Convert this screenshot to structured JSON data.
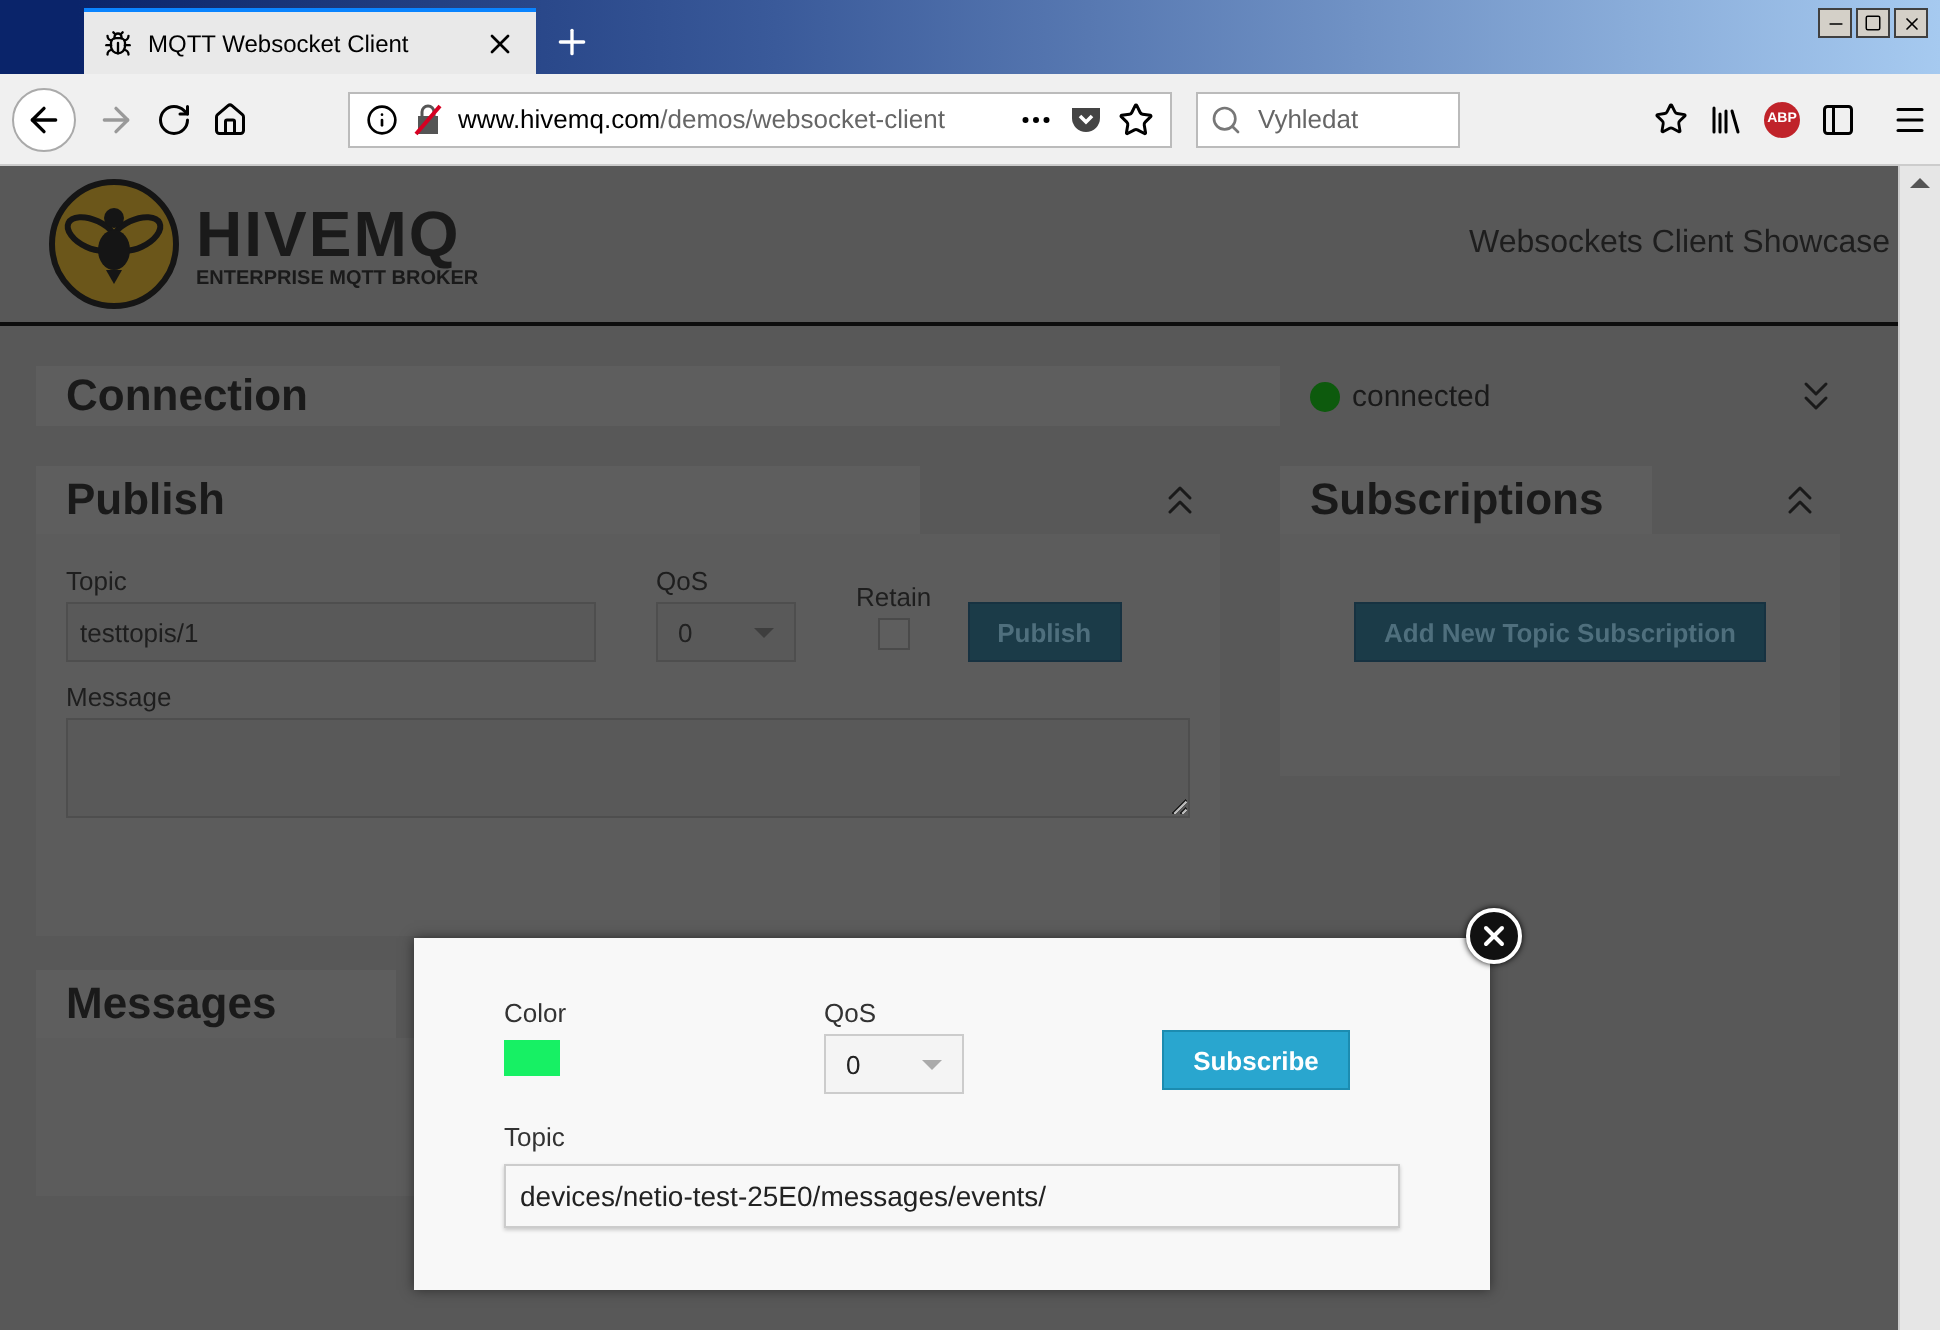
{
  "browser": {
    "tab_title": "MQTT Websocket Client",
    "url_host": "www.hivemq.com",
    "url_path": "/demos/websocket-client",
    "search_placeholder": "Vyhledat",
    "adblock_badge": "ABP"
  },
  "header": {
    "brand": "HIVEMQ",
    "tagline": "ENTERPRISE MQTT BROKER",
    "showcase": "Websockets Client Showcase"
  },
  "connection": {
    "title": "Connection",
    "connected": true,
    "status": "connected",
    "expanded": false
  },
  "publish": {
    "title": "Publish",
    "expanded": true,
    "topic_label": "Topic",
    "topic": "testtopis/1",
    "qos_label": "QoS",
    "qos": "0",
    "retain_label": "Retain",
    "retain": false,
    "button": "Publish",
    "message_label": "Message"
  },
  "subscriptions": {
    "title": "Subscriptions",
    "expanded": true,
    "button": "Add New Topic Subscription"
  },
  "messages": {
    "title": "Messages"
  },
  "dialog": {
    "color_label": "Color",
    "color": "#17f064",
    "qos_label": "QoS",
    "qos": "0",
    "button": "Subscribe",
    "topic_label": "Topic",
    "topic": "devices/netio-test-25E0/messages/events/"
  }
}
